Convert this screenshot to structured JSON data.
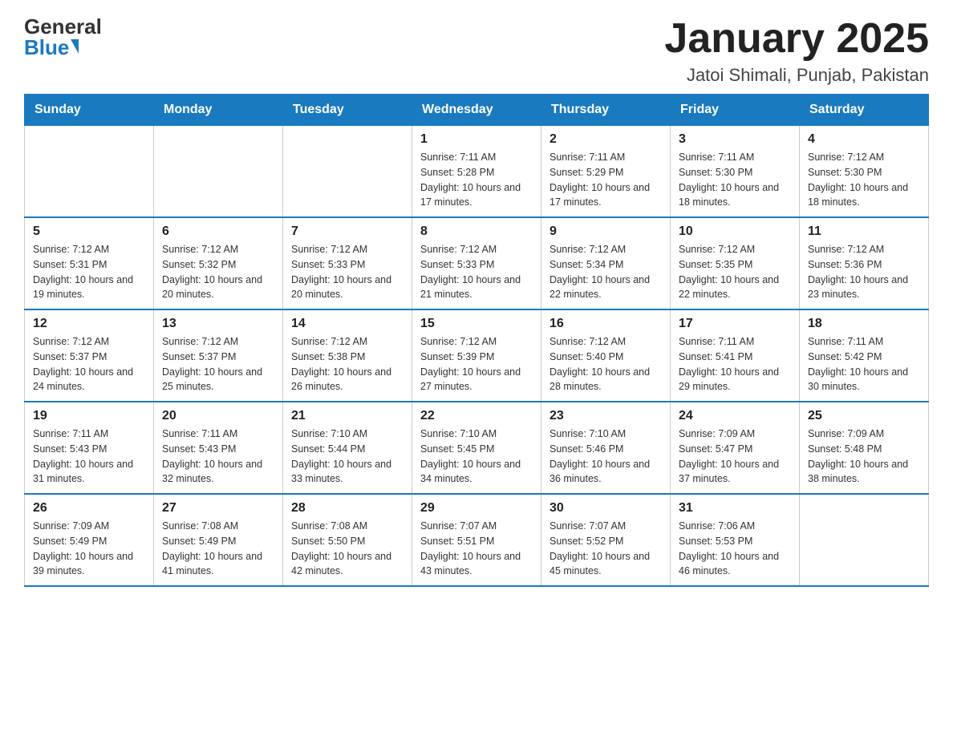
{
  "logo": {
    "general": "General",
    "blue": "Blue"
  },
  "title": "January 2025",
  "subtitle": "Jatoi Shimali, Punjab, Pakistan",
  "headers": [
    "Sunday",
    "Monday",
    "Tuesday",
    "Wednesday",
    "Thursday",
    "Friday",
    "Saturday"
  ],
  "weeks": [
    [
      {
        "day": "",
        "info": ""
      },
      {
        "day": "",
        "info": ""
      },
      {
        "day": "",
        "info": ""
      },
      {
        "day": "1",
        "info": "Sunrise: 7:11 AM\nSunset: 5:28 PM\nDaylight: 10 hours and 17 minutes."
      },
      {
        "day": "2",
        "info": "Sunrise: 7:11 AM\nSunset: 5:29 PM\nDaylight: 10 hours and 17 minutes."
      },
      {
        "day": "3",
        "info": "Sunrise: 7:11 AM\nSunset: 5:30 PM\nDaylight: 10 hours and 18 minutes."
      },
      {
        "day": "4",
        "info": "Sunrise: 7:12 AM\nSunset: 5:30 PM\nDaylight: 10 hours and 18 minutes."
      }
    ],
    [
      {
        "day": "5",
        "info": "Sunrise: 7:12 AM\nSunset: 5:31 PM\nDaylight: 10 hours and 19 minutes."
      },
      {
        "day": "6",
        "info": "Sunrise: 7:12 AM\nSunset: 5:32 PM\nDaylight: 10 hours and 20 minutes."
      },
      {
        "day": "7",
        "info": "Sunrise: 7:12 AM\nSunset: 5:33 PM\nDaylight: 10 hours and 20 minutes."
      },
      {
        "day": "8",
        "info": "Sunrise: 7:12 AM\nSunset: 5:33 PM\nDaylight: 10 hours and 21 minutes."
      },
      {
        "day": "9",
        "info": "Sunrise: 7:12 AM\nSunset: 5:34 PM\nDaylight: 10 hours and 22 minutes."
      },
      {
        "day": "10",
        "info": "Sunrise: 7:12 AM\nSunset: 5:35 PM\nDaylight: 10 hours and 22 minutes."
      },
      {
        "day": "11",
        "info": "Sunrise: 7:12 AM\nSunset: 5:36 PM\nDaylight: 10 hours and 23 minutes."
      }
    ],
    [
      {
        "day": "12",
        "info": "Sunrise: 7:12 AM\nSunset: 5:37 PM\nDaylight: 10 hours and 24 minutes."
      },
      {
        "day": "13",
        "info": "Sunrise: 7:12 AM\nSunset: 5:37 PM\nDaylight: 10 hours and 25 minutes."
      },
      {
        "day": "14",
        "info": "Sunrise: 7:12 AM\nSunset: 5:38 PM\nDaylight: 10 hours and 26 minutes."
      },
      {
        "day": "15",
        "info": "Sunrise: 7:12 AM\nSunset: 5:39 PM\nDaylight: 10 hours and 27 minutes."
      },
      {
        "day": "16",
        "info": "Sunrise: 7:12 AM\nSunset: 5:40 PM\nDaylight: 10 hours and 28 minutes."
      },
      {
        "day": "17",
        "info": "Sunrise: 7:11 AM\nSunset: 5:41 PM\nDaylight: 10 hours and 29 minutes."
      },
      {
        "day": "18",
        "info": "Sunrise: 7:11 AM\nSunset: 5:42 PM\nDaylight: 10 hours and 30 minutes."
      }
    ],
    [
      {
        "day": "19",
        "info": "Sunrise: 7:11 AM\nSunset: 5:43 PM\nDaylight: 10 hours and 31 minutes."
      },
      {
        "day": "20",
        "info": "Sunrise: 7:11 AM\nSunset: 5:43 PM\nDaylight: 10 hours and 32 minutes."
      },
      {
        "day": "21",
        "info": "Sunrise: 7:10 AM\nSunset: 5:44 PM\nDaylight: 10 hours and 33 minutes."
      },
      {
        "day": "22",
        "info": "Sunrise: 7:10 AM\nSunset: 5:45 PM\nDaylight: 10 hours and 34 minutes."
      },
      {
        "day": "23",
        "info": "Sunrise: 7:10 AM\nSunset: 5:46 PM\nDaylight: 10 hours and 36 minutes."
      },
      {
        "day": "24",
        "info": "Sunrise: 7:09 AM\nSunset: 5:47 PM\nDaylight: 10 hours and 37 minutes."
      },
      {
        "day": "25",
        "info": "Sunrise: 7:09 AM\nSunset: 5:48 PM\nDaylight: 10 hours and 38 minutes."
      }
    ],
    [
      {
        "day": "26",
        "info": "Sunrise: 7:09 AM\nSunset: 5:49 PM\nDaylight: 10 hours and 39 minutes."
      },
      {
        "day": "27",
        "info": "Sunrise: 7:08 AM\nSunset: 5:49 PM\nDaylight: 10 hours and 41 minutes."
      },
      {
        "day": "28",
        "info": "Sunrise: 7:08 AM\nSunset: 5:50 PM\nDaylight: 10 hours and 42 minutes."
      },
      {
        "day": "29",
        "info": "Sunrise: 7:07 AM\nSunset: 5:51 PM\nDaylight: 10 hours and 43 minutes."
      },
      {
        "day": "30",
        "info": "Sunrise: 7:07 AM\nSunset: 5:52 PM\nDaylight: 10 hours and 45 minutes."
      },
      {
        "day": "31",
        "info": "Sunrise: 7:06 AM\nSunset: 5:53 PM\nDaylight: 10 hours and 46 minutes."
      },
      {
        "day": "",
        "info": ""
      }
    ]
  ]
}
